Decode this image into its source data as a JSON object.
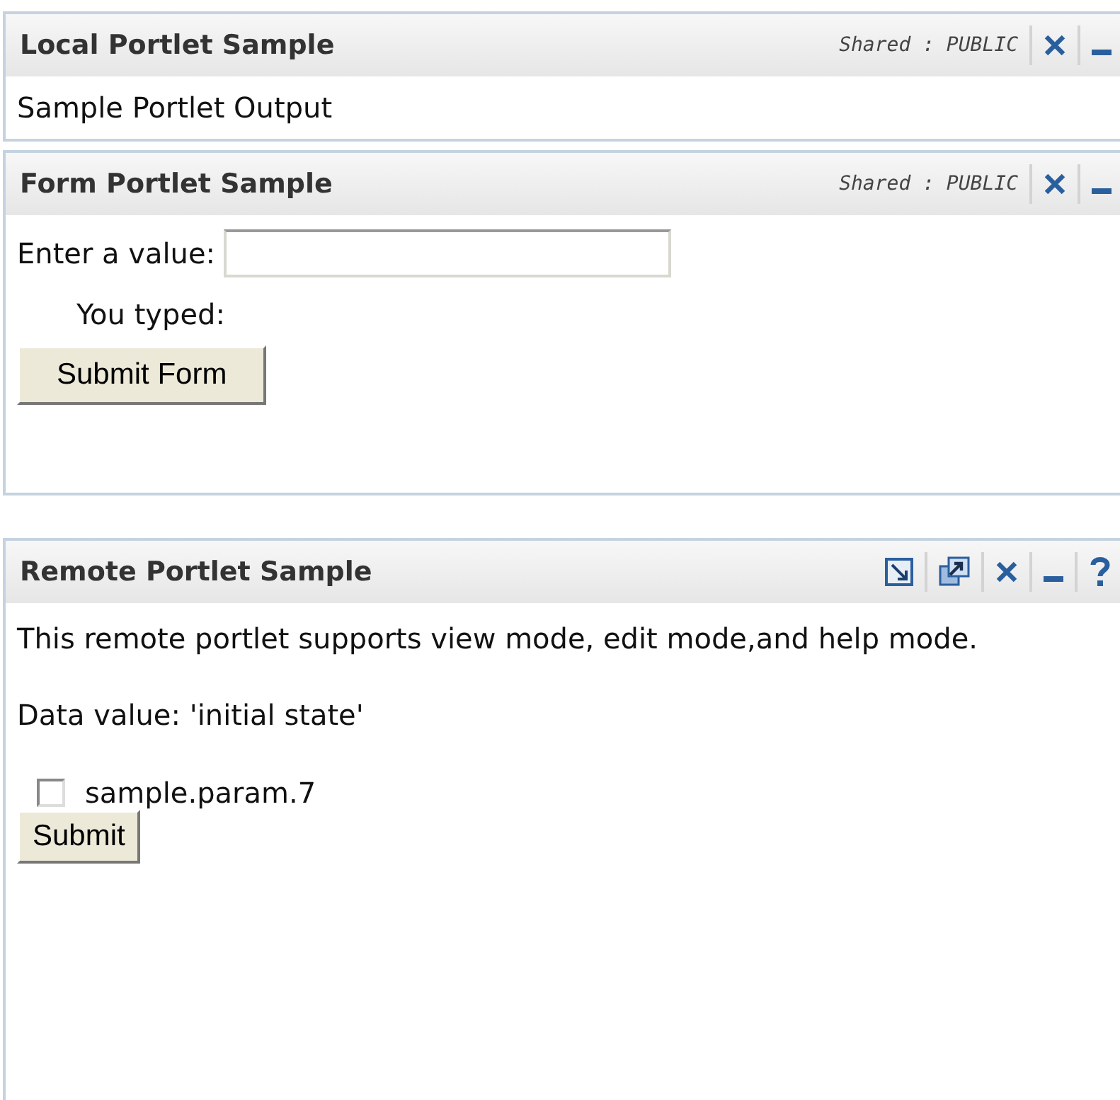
{
  "portlets": [
    {
      "title": "Local Portlet Sample",
      "shared": "Shared : PUBLIC",
      "controls": [
        {
          "kind": "close"
        },
        {
          "kind": "minimize"
        }
      ],
      "kind": "text",
      "paragraphs": [
        "Sample Portlet Output"
      ]
    },
    {
      "title": "Form Portlet Sample",
      "shared": "Shared : PUBLIC",
      "controls": [
        {
          "kind": "close"
        },
        {
          "kind": "minimize"
        }
      ],
      "kind": "form",
      "field_label": "Enter a value:",
      "typed_label": "You typed:",
      "button": "Submit Form"
    },
    {
      "title": "Remote Portlet Sample",
      "controls": [
        {
          "kind": "edit"
        },
        {
          "kind": "popout"
        },
        {
          "kind": "close"
        },
        {
          "kind": "minimize"
        },
        {
          "kind": "help"
        }
      ],
      "kind": "remote",
      "paragraphs": [
        "This remote portlet supports view mode, edit mode,and help mode.",
        "Data value: 'initial state'"
      ],
      "checkbox": {
        "label": "sample.param.7",
        "checked": false
      },
      "button": "Submit"
    }
  ]
}
